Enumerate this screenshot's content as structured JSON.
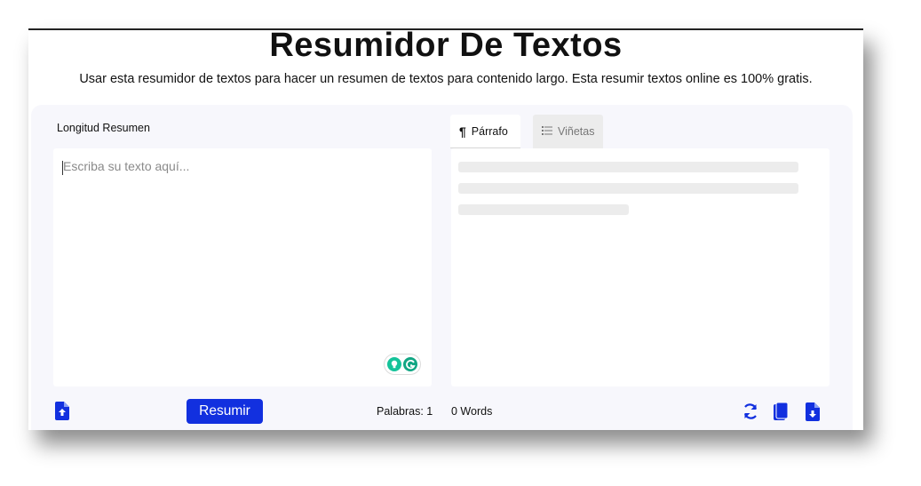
{
  "page": {
    "title": "Resumidor De Textos",
    "subtitle": "Usar esta resumidor de textos para hacer un resumen de textos para contenido largo. Esta resumir textos online es 100% gratis."
  },
  "input": {
    "length_label": "Longitud Resumen",
    "placeholder": "Escriba su texto aquí...",
    "value": ""
  },
  "tabs": [
    {
      "label": "Párrafo",
      "icon": "pilcrow-icon",
      "active": true
    },
    {
      "label": "Viñetas",
      "icon": "list-icon",
      "active": false
    }
  ],
  "bottom": {
    "resumir_label": "Resumir",
    "words_left": "Palabras: 1",
    "words_right": "0 Words"
  },
  "icons": {
    "upload": "file-upload-icon",
    "refresh": "refresh-icon",
    "copy": "copy-icon",
    "download": "file-download-icon",
    "grammarly": "grammarly-icon",
    "bulb": "lightbulb-icon"
  },
  "colors": {
    "accent": "#1230df",
    "panel_bg": "#f7f7fc",
    "skeleton": "#ececec",
    "grammarly": "#15c39a"
  }
}
